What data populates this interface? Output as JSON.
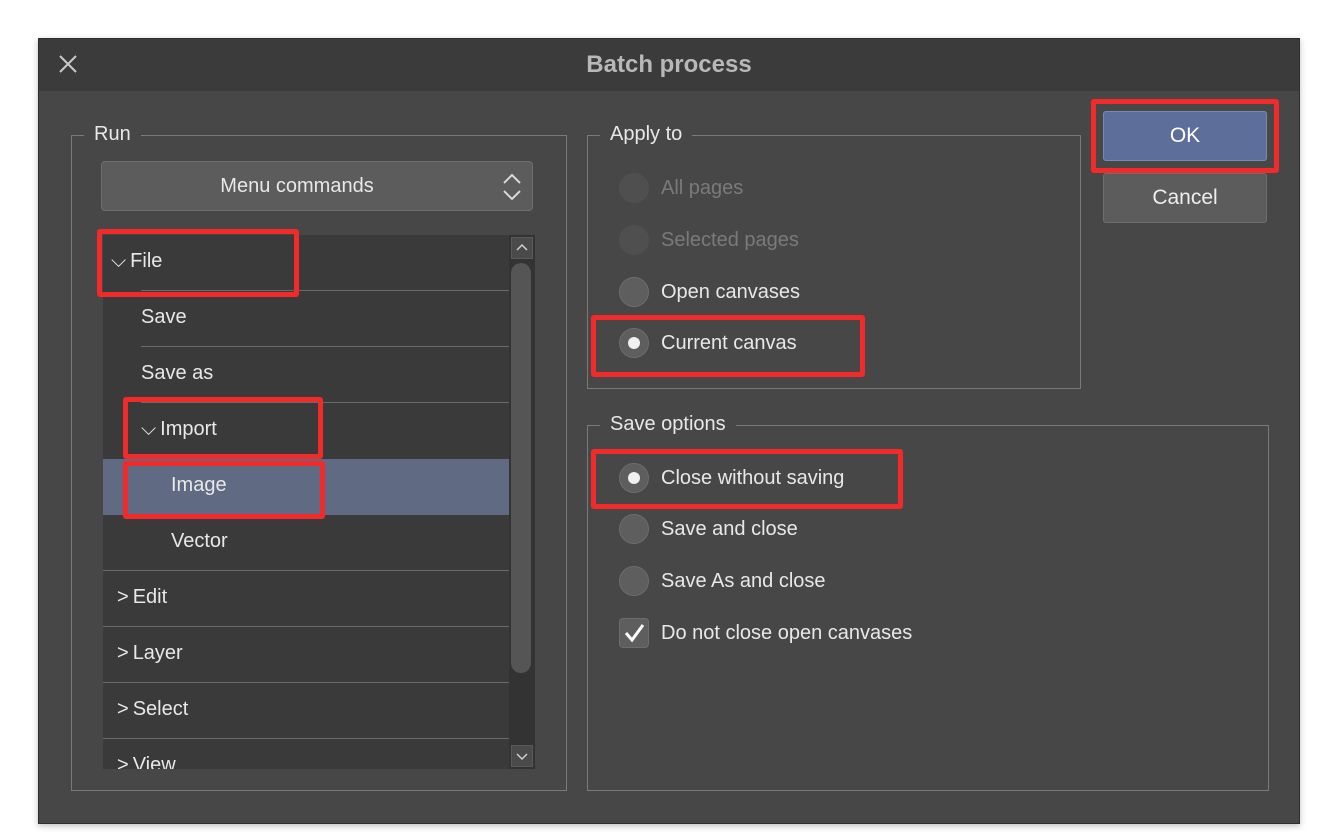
{
  "dialog": {
    "title": "Batch process"
  },
  "run": {
    "legend": "Run",
    "select_value": "Menu commands",
    "tree": [
      {
        "label": "File",
        "prefix": "⌵",
        "indent": 8
      },
      {
        "label": "Save",
        "prefix": "",
        "indent": 38
      },
      {
        "label": "Save as",
        "prefix": "",
        "indent": 38
      },
      {
        "label": "Import",
        "prefix": "⌵",
        "indent": 38
      },
      {
        "label": "Image",
        "prefix": "",
        "indent": 68
      },
      {
        "label": "Vector",
        "prefix": "",
        "indent": 68
      },
      {
        "label": "Edit",
        "prefix": ">",
        "indent": 14
      },
      {
        "label": "Layer",
        "prefix": ">",
        "indent": 14
      },
      {
        "label": "Select",
        "prefix": ">",
        "indent": 14
      },
      {
        "label": "View",
        "prefix": ">",
        "indent": 14
      }
    ]
  },
  "apply_to": {
    "legend": "Apply to",
    "options": [
      "All pages",
      "Selected pages",
      "Open canvases",
      "Current canvas"
    ],
    "selected": "Current canvas"
  },
  "save_options": {
    "legend": "Save options",
    "options": [
      "Close without saving",
      "Save and close",
      "Save As and close"
    ],
    "selected": "Close without saving",
    "checkbox_label": "Do not close open canvases",
    "checkbox_checked": true
  },
  "buttons": {
    "ok": "OK",
    "cancel": "Cancel"
  },
  "colors": {
    "highlight": "#f22a2a",
    "selected_row": "#606a82",
    "ok_button": "#5d6e9a"
  }
}
